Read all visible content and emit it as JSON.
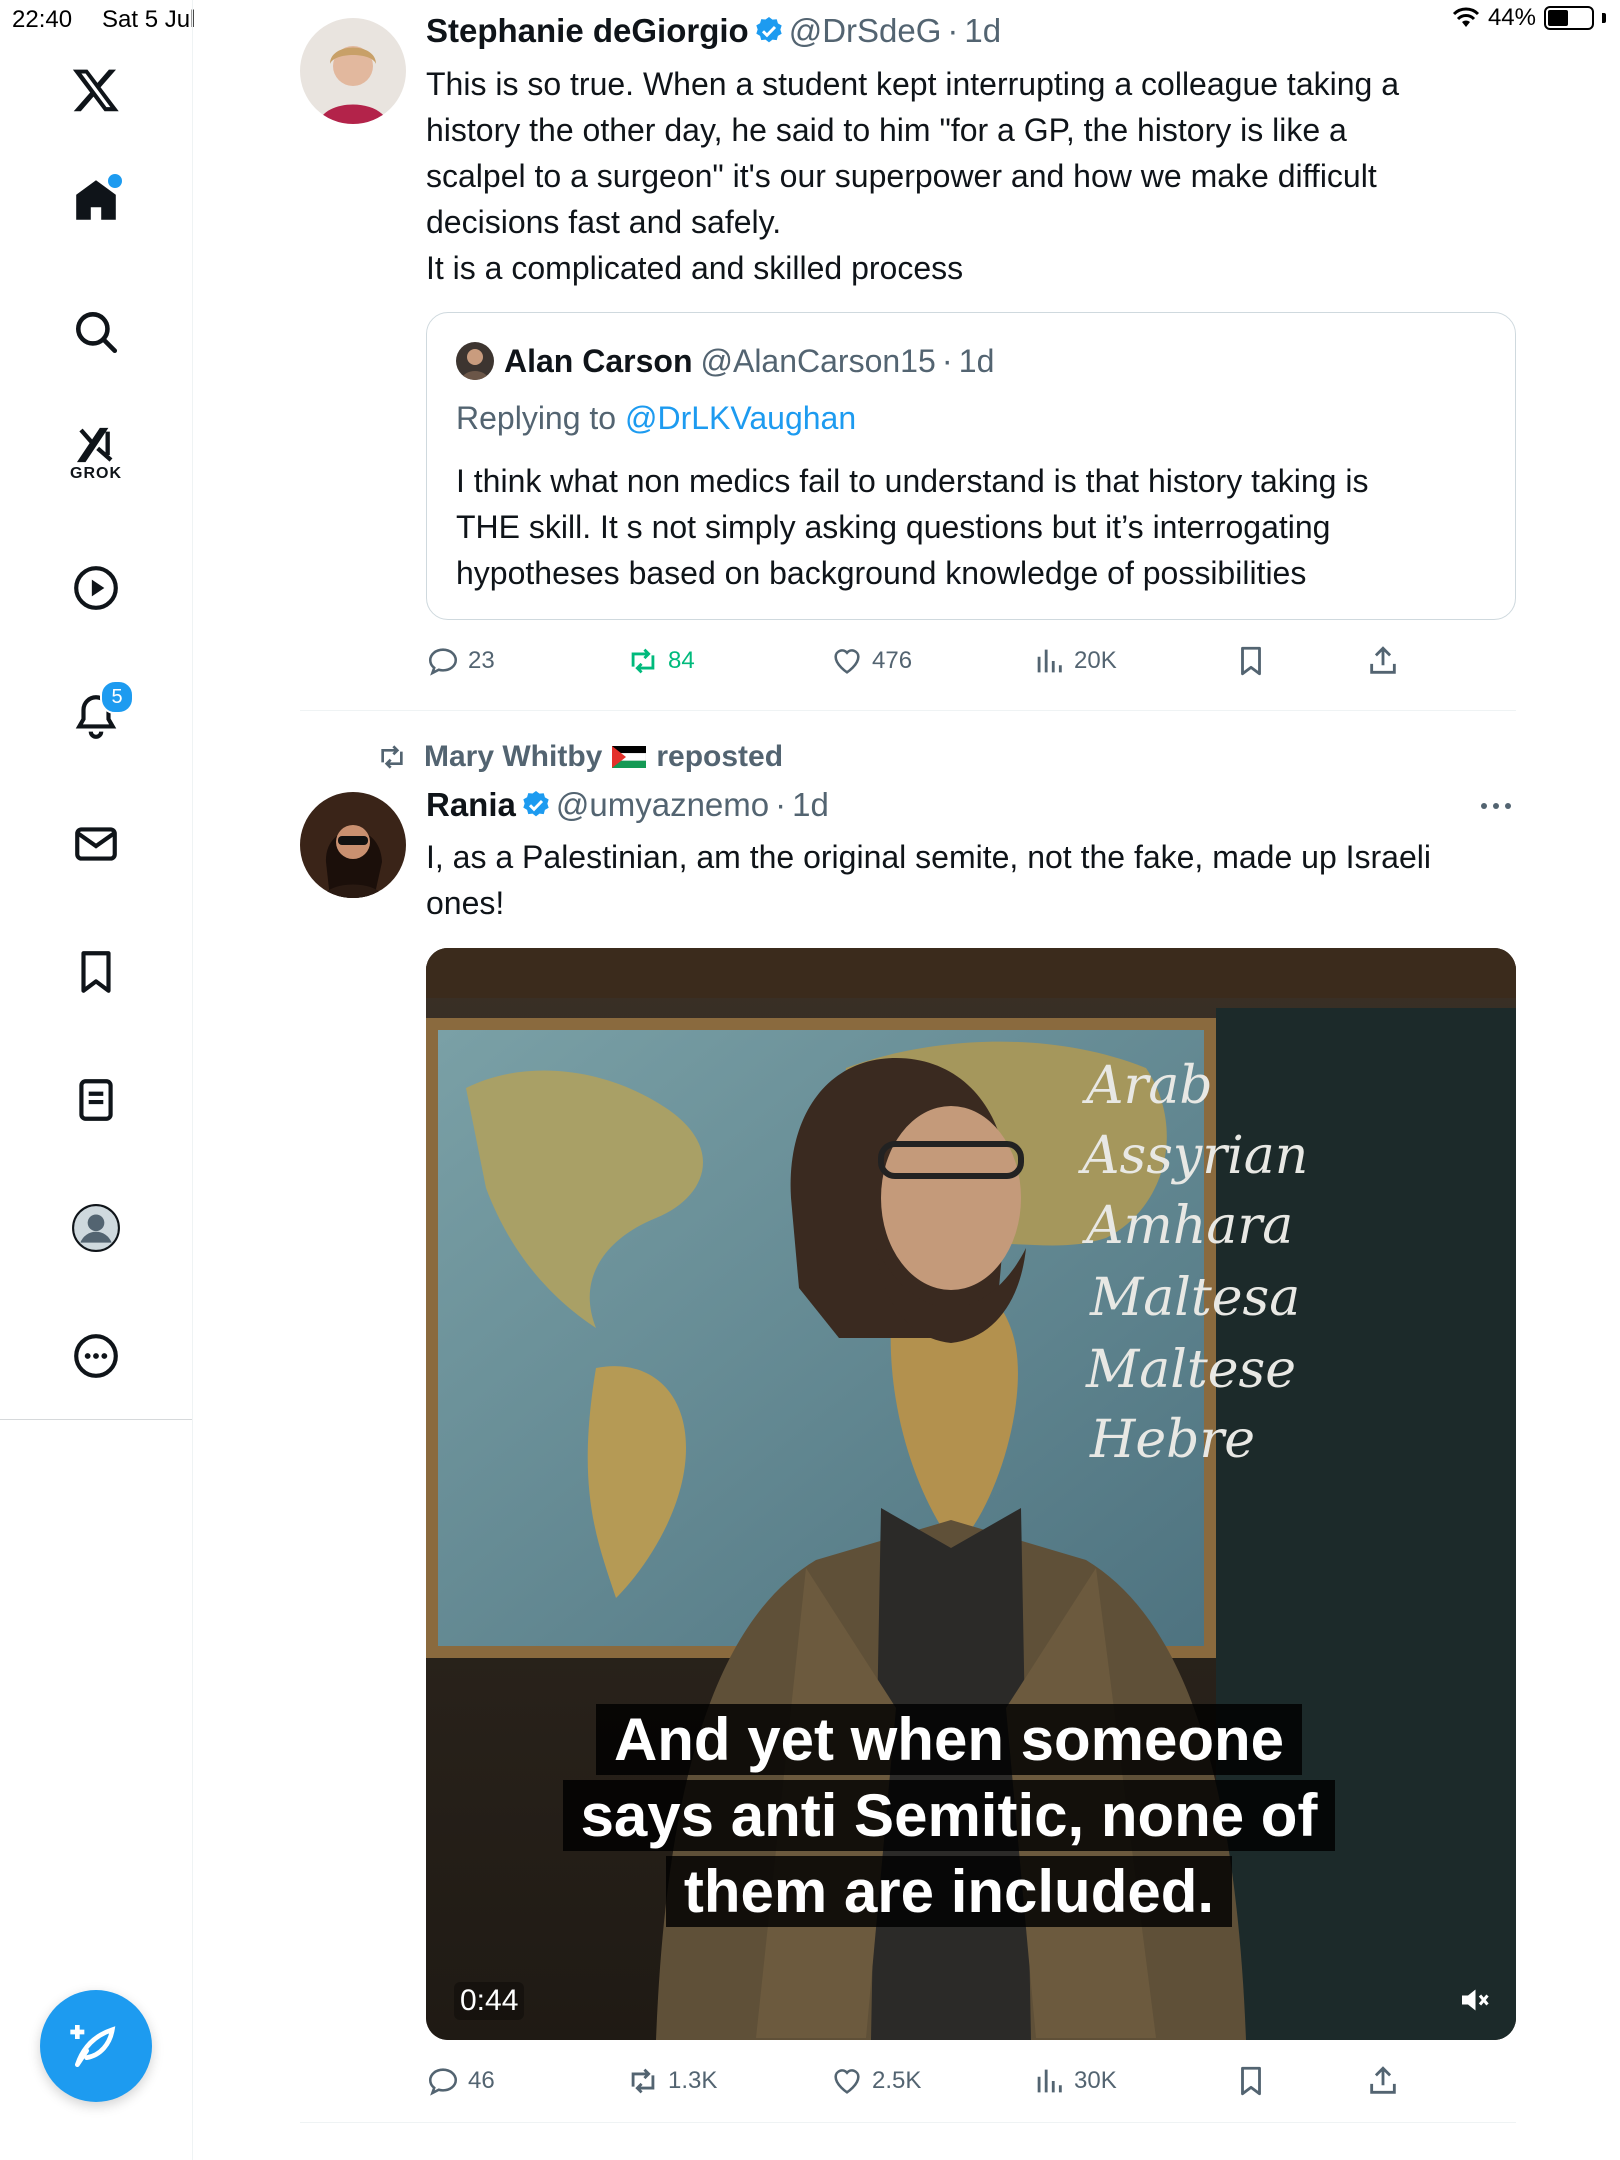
{
  "status_bar": {
    "time": "22:40",
    "date": "Sat 5 Jul",
    "battery": "44%"
  },
  "sidebar": {
    "items": [
      {
        "name": "x-logo"
      },
      {
        "name": "home"
      },
      {
        "name": "search"
      },
      {
        "name": "grok",
        "label": "GROK"
      },
      {
        "name": "video"
      },
      {
        "name": "notifications",
        "badge": "5"
      },
      {
        "name": "messages"
      },
      {
        "name": "bookmarks"
      },
      {
        "name": "lists"
      },
      {
        "name": "profile"
      },
      {
        "name": "more"
      }
    ]
  },
  "tweet1": {
    "name": "Stephanie deGiorgio",
    "handle": "@DrSdeG",
    "sep": "·",
    "time": "1d",
    "lines": [
      "This is so true. When a student kept interrupting a colleague taking a",
      "history the other day, he said to him \"for a GP, the history is like a",
      "scalpel to a surgeon\" it's our superpower and how we make difficult",
      "decisions fast and safely.",
      "It is a complicated and skilled process"
    ],
    "quote": {
      "name": "Alan Carson",
      "handle": "@AlanCarson15",
      "sep": "·",
      "time": "1d",
      "replying_prefix": "Replying to",
      "replying_to": "@DrLKVaughan",
      "lines": [
        "I think what non medics fail to understand is that history taking is",
        "THE skill. It s not simply asking questions but it’s interrogating",
        "hypotheses based on background knowledge of possibilities"
      ]
    },
    "stats": {
      "replies": "23",
      "reposts": "84",
      "likes": "476",
      "views": "20K"
    }
  },
  "tweet2": {
    "repost_by": "Mary Whitby",
    "repost_label": "reposted",
    "name": "Rania",
    "handle": "@umyaznemo",
    "sep": "·",
    "time": "1d",
    "lines": [
      "I, as a Palestinian, am the original semite, not the fake, made up Israeli",
      "ones!"
    ],
    "video": {
      "caption_lines": [
        "And yet when someone",
        "says anti Semitic, none of",
        "them are included."
      ],
      "duration": "0:44",
      "chalkboard": [
        "Arab",
        "Assyrian",
        "Amhara",
        "Maltesa",
        "Maltese",
        "Hebre"
      ]
    },
    "stats": {
      "replies": "46",
      "reposts": "1.3K",
      "likes": "2.5K",
      "views": "30K"
    }
  },
  "colors": {
    "accent": "#1d9bf0",
    "repost_green": "#00ba7c",
    "secondary": "#536471"
  }
}
